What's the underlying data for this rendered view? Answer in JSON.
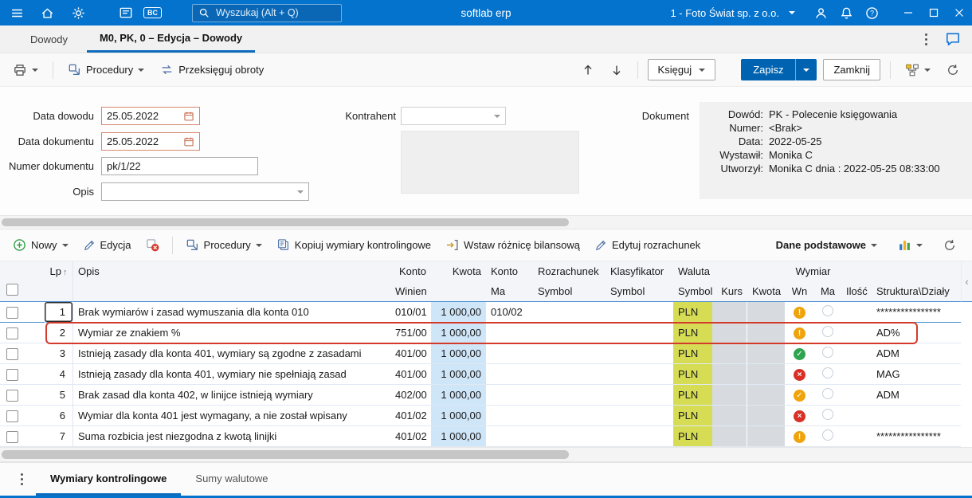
{
  "colors": {
    "titlebar": "#0473cd",
    "accent": "#0d6cbd",
    "save_button": "#0063b1",
    "kwota_cell": "#cfe5f8",
    "pln_cell": "#d6dd55",
    "disabled_cell": "#d7dbdf",
    "status_ok": "#2ea44f",
    "status_warning": "#f0a30a",
    "status_error": "#d93026",
    "highlight_border": "#d43a2a"
  },
  "icons": [
    "menu-icon",
    "home-icon",
    "settings-icon",
    "documents-icon",
    "bc-badge-icon",
    "search-icon",
    "user-icon",
    "bell-icon",
    "help-icon",
    "minimize-icon",
    "maximize-icon",
    "close-icon",
    "comment-icon",
    "printer-icon",
    "procedures-icon",
    "transfer-icon",
    "arrow-up-icon",
    "arrow-down-icon",
    "workflow-icon",
    "refresh-icon",
    "calendar-icon",
    "plus-circle-icon",
    "pencil-icon",
    "delete-icon",
    "copy-icon",
    "insert-balance-icon",
    "chart-bars-icon",
    "chevron-down-icon",
    "more-options-icon",
    "empty-circle-icon"
  ],
  "glyphs": {
    "sort_asc": "↑",
    "collapse_left": "‹"
  },
  "titlebar": {
    "app_title": "softlab erp",
    "search_placeholder": "Wyszukaj (Alt + Q)",
    "company": "1 - Foto Świat sp. z o.o.",
    "bc_badge": "BC"
  },
  "tabs": {
    "back": "Dowody",
    "active": "M0, PK, 0 – Edycja – Dowody"
  },
  "toolbar": {
    "procedury": "Procedury",
    "przeksieguj_obroty": "Przeksięguj obroty",
    "ksieguj": "Księguj",
    "zapisz": "Zapisz",
    "zamknij": "Zamknij"
  },
  "form": {
    "fields": {
      "data_dowodu": {
        "label": "Data dowodu",
        "value": "25.05.2022"
      },
      "data_dokumentu": {
        "label": "Data dokumentu",
        "value": "25.05.2022"
      },
      "numer_dokumentu": {
        "label": "Numer dokumentu",
        "value": "pk/1/22"
      },
      "opis": {
        "label": "Opis",
        "value": ""
      },
      "kontrahent": {
        "label": "Kontrahent",
        "value": ""
      }
    },
    "dokument": {
      "label": "Dokument",
      "rows": [
        {
          "label": "Dowód:",
          "value": "PK - Polecenie księgowania"
        },
        {
          "label": "Numer:",
          "value": "<Brak>"
        },
        {
          "label": "Data:",
          "value": "2022-05-25"
        },
        {
          "label": "Wystawił:",
          "value": "Monika C"
        },
        {
          "label": "Utworzył:",
          "value": "Monika C dnia : 2022-05-25 08:33:00"
        }
      ]
    }
  },
  "grid_toolbar": {
    "nowy": "Nowy",
    "edycja": "Edycja",
    "procedury": "Procedury",
    "kopiuj": "Kopiuj wymiary kontrolingowe",
    "wstaw": "Wstaw różnicę bilansową",
    "edytuj": "Edytuj rozrachunek",
    "dane_podstawowe": "Dane podstawowe"
  },
  "grid": {
    "header": {
      "lp": "Lp",
      "opis": "Opis",
      "konto_winien_top": "Konto",
      "winien": "Winien",
      "kwota": "Kwota",
      "konto_ma_top": "Konto",
      "ma": "Ma",
      "rozrachunek": "Rozrachunek",
      "rozrachunek_symbol": "Symbol",
      "klasyfikator": "Klasyfikator",
      "klasyfikator_symbol": "Symbol",
      "waluta": "Waluta",
      "waluta_symbol": "Symbol",
      "kurs": "Kurs",
      "kwota_waluta": "Kwota",
      "wymiar": "Wymiar",
      "wn": "Wn",
      "ma2": "Ma",
      "ilosc": "Ilość",
      "struktura": "Struktura\\Działy"
    },
    "rows": [
      {
        "lp": "1",
        "opis": "Brak wymiarów i zasad wymuszania dla konta 010",
        "konto_winien": "010/01",
        "kwota": "1 000,00",
        "konto_ma": "010/02",
        "rozrachunek": "",
        "klasyfikator": "",
        "waluta": "PLN",
        "kurs": "",
        "kwota2": "",
        "wn": "warning",
        "ilosc": "",
        "struktura": "****************",
        "highlight": false
      },
      {
        "lp": "2",
        "opis": "Wymiar ze znakiem %",
        "konto_winien": "751/00",
        "kwota": "1 000,00",
        "konto_ma": "",
        "rozrachunek": "",
        "klasyfikator": "",
        "waluta": "PLN",
        "kurs": "",
        "kwota2": "",
        "wn": "warning",
        "ilosc": "",
        "struktura": "AD%",
        "highlight": true
      },
      {
        "lp": "3",
        "opis": "Istnieją zasady dla konta 401, wymiary są zgodne z zasadami",
        "konto_winien": "401/00",
        "kwota": "1 000,00",
        "konto_ma": "",
        "rozrachunek": "",
        "klasyfikator": "",
        "waluta": "PLN",
        "kurs": "",
        "kwota2": "",
        "wn": "ok",
        "ilosc": "",
        "struktura": "ADM",
        "highlight": false
      },
      {
        "lp": "4",
        "opis": "Istnieją zasady dla konta 401, wymiary nie spełniają zasad",
        "konto_winien": "401/00",
        "kwota": "1 000,00",
        "konto_ma": "",
        "rozrachunek": "",
        "klasyfikator": "",
        "waluta": "PLN",
        "kurs": "",
        "kwota2": "",
        "wn": "error",
        "ilosc": "",
        "struktura": "MAG",
        "highlight": false
      },
      {
        "lp": "5",
        "opis": "Brak zasad dla konta 402, w linijce istnieją wymiary",
        "konto_winien": "402/00",
        "kwota": "1 000,00",
        "konto_ma": "",
        "rozrachunek": "",
        "klasyfikator": "",
        "waluta": "PLN",
        "kurs": "",
        "kwota2": "",
        "wn": "ok_warn",
        "ilosc": "",
        "struktura": "ADM",
        "highlight": false
      },
      {
        "lp": "6",
        "opis": "Wymiar dla konta 401 jest wymagany, a nie został wpisany",
        "konto_winien": "401/02",
        "kwota": "1 000,00",
        "konto_ma": "",
        "rozrachunek": "",
        "klasyfikator": "",
        "waluta": "PLN",
        "kurs": "",
        "kwota2": "",
        "wn": "error",
        "ilosc": "",
        "struktura": "",
        "highlight": false
      },
      {
        "lp": "7",
        "opis": "Suma rozbicia jest niezgodna z kwotą linijki",
        "konto_winien": "401/02",
        "kwota": "1 000,00",
        "konto_ma": "",
        "rozrachunek": "",
        "klasyfikator": "",
        "waluta": "PLN",
        "kurs": "",
        "kwota2": "",
        "wn": "warning",
        "ilosc": "",
        "struktura": "****************",
        "highlight": false
      }
    ]
  },
  "bottom_tabs": {
    "active": "Wymiary kontrolingowe",
    "inactive": "Sumy walutowe"
  }
}
